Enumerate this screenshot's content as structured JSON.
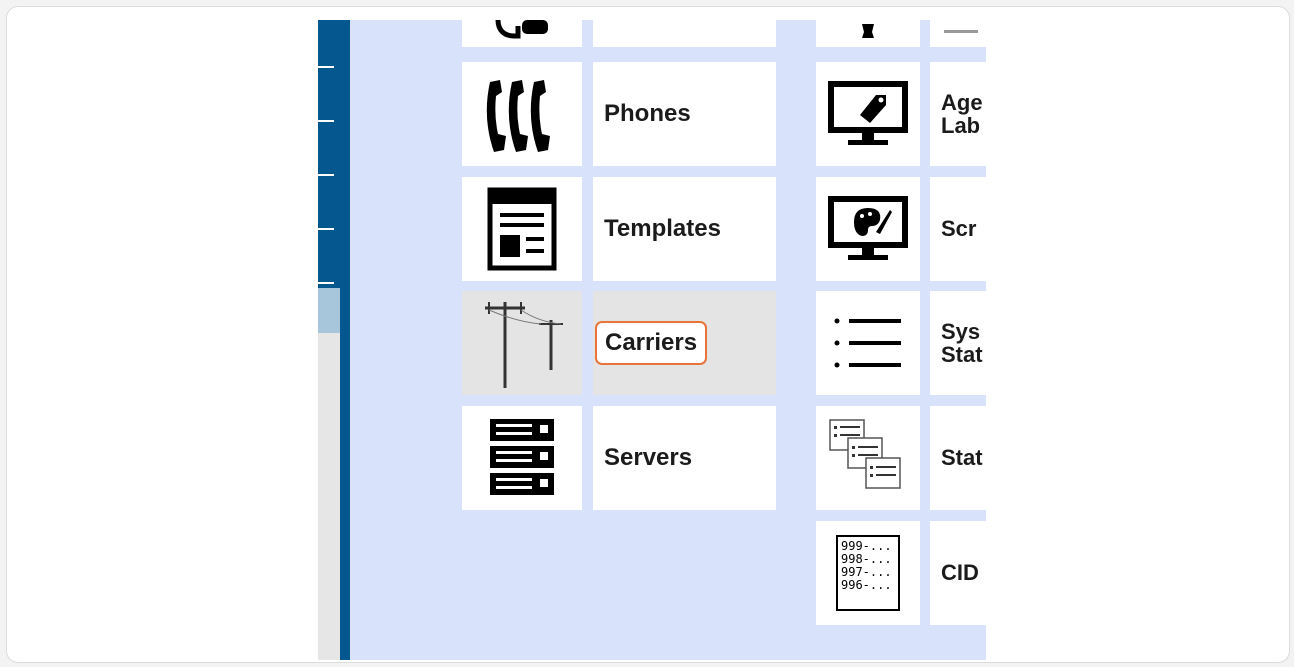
{
  "admin_menu": {
    "column1": [
      {
        "label": "Phones",
        "icon": "phones-icon"
      },
      {
        "label": "Templates",
        "icon": "templates-icon"
      },
      {
        "label": "Carriers",
        "icon": "carriers-icon",
        "selected": true
      },
      {
        "label": "Servers",
        "icon": "servers-icon"
      }
    ],
    "column2": [
      {
        "label": "Age Lab",
        "icon": "agent-labels-icon"
      },
      {
        "label": "Scr",
        "icon": "screen-colors-icon"
      },
      {
        "label": "Sys Stat",
        "icon": "system-statuses-icon"
      },
      {
        "label": "Stat",
        "icon": "status-groups-icon"
      },
      {
        "label": "CID",
        "icon": "cid-groups-icon"
      }
    ],
    "cid_icon_lines": [
      "999-...",
      "998-...",
      "997-...",
      "996-..."
    ]
  },
  "colors": {
    "sidebar_blue": "#04578f",
    "sidebar_light": "#a7c6db",
    "panel_background": "#d8e3fb",
    "highlight_border": "#e8743b",
    "selected_tile": "#e4e4e4"
  }
}
